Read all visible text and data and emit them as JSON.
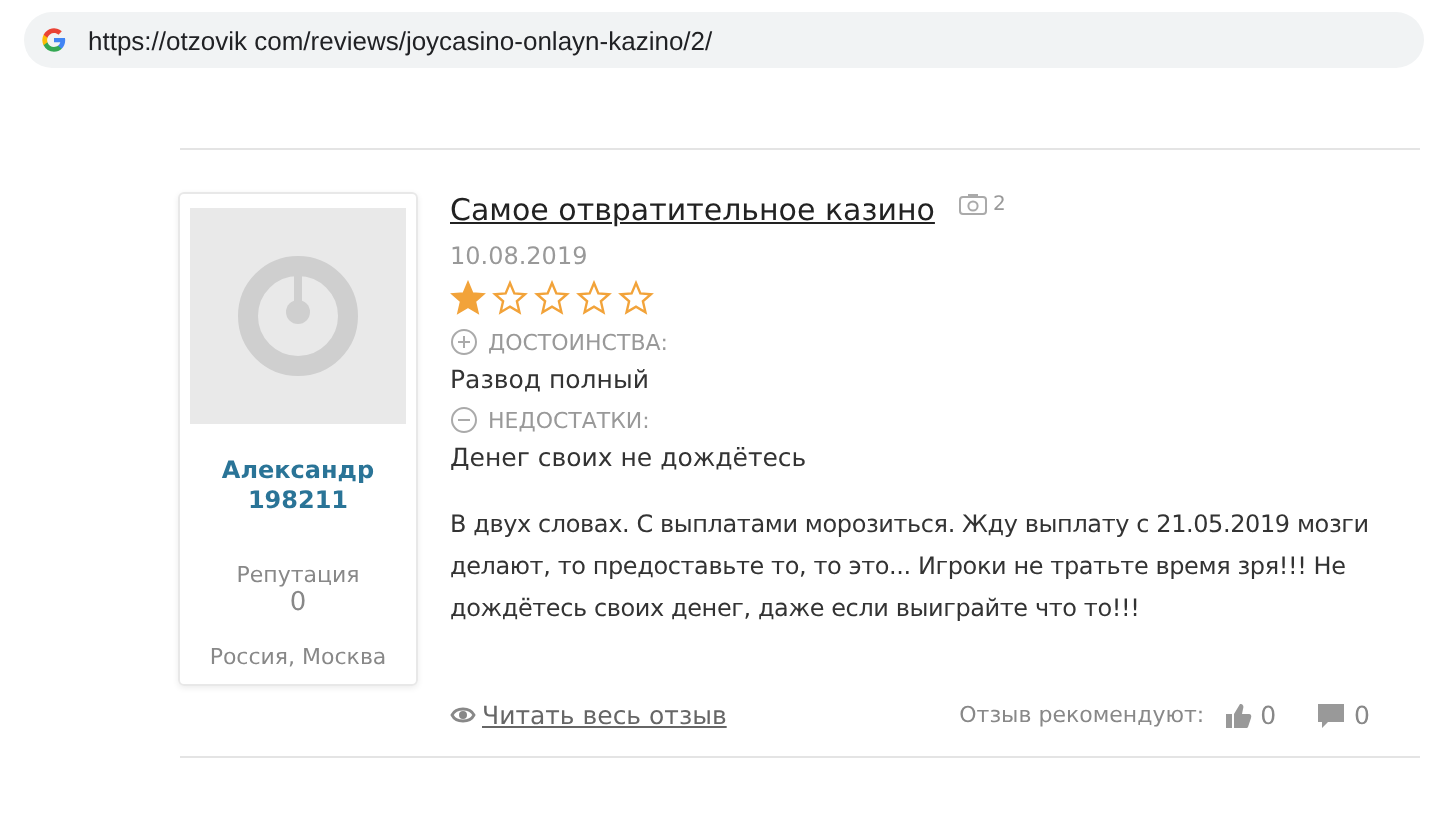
{
  "address_bar": {
    "url": "https://otzovik com/reviews/joycasino-onlayn-kazino/2/"
  },
  "review": {
    "author": {
      "name": "Александр",
      "id": "198211",
      "reputation_label": "Репутация",
      "reputation": "0",
      "location": "Россия, Москва"
    },
    "title": "Самое отвратительное казино",
    "photo_count": "2",
    "date": "10.08.2019",
    "stars": 1,
    "pros_label": "ДОСТОИНСТВА:",
    "pros": "Развод полный",
    "cons_label": "НЕДОСТАТКИ:",
    "cons": "Денег своих не дождётесь",
    "text": "В двух словах. С выплатами морозиться. Жду выплату с 21.05.2019 мозги делают, то предоставьте то, то это... Игроки не тратьте время зря!!! Не дождётесь своих денег, даже если выиграйте что то!!!",
    "read_more": "Читать весь отзыв",
    "recommend_label": "Отзыв рекомендуют:",
    "likes": "0",
    "comments": "0"
  }
}
